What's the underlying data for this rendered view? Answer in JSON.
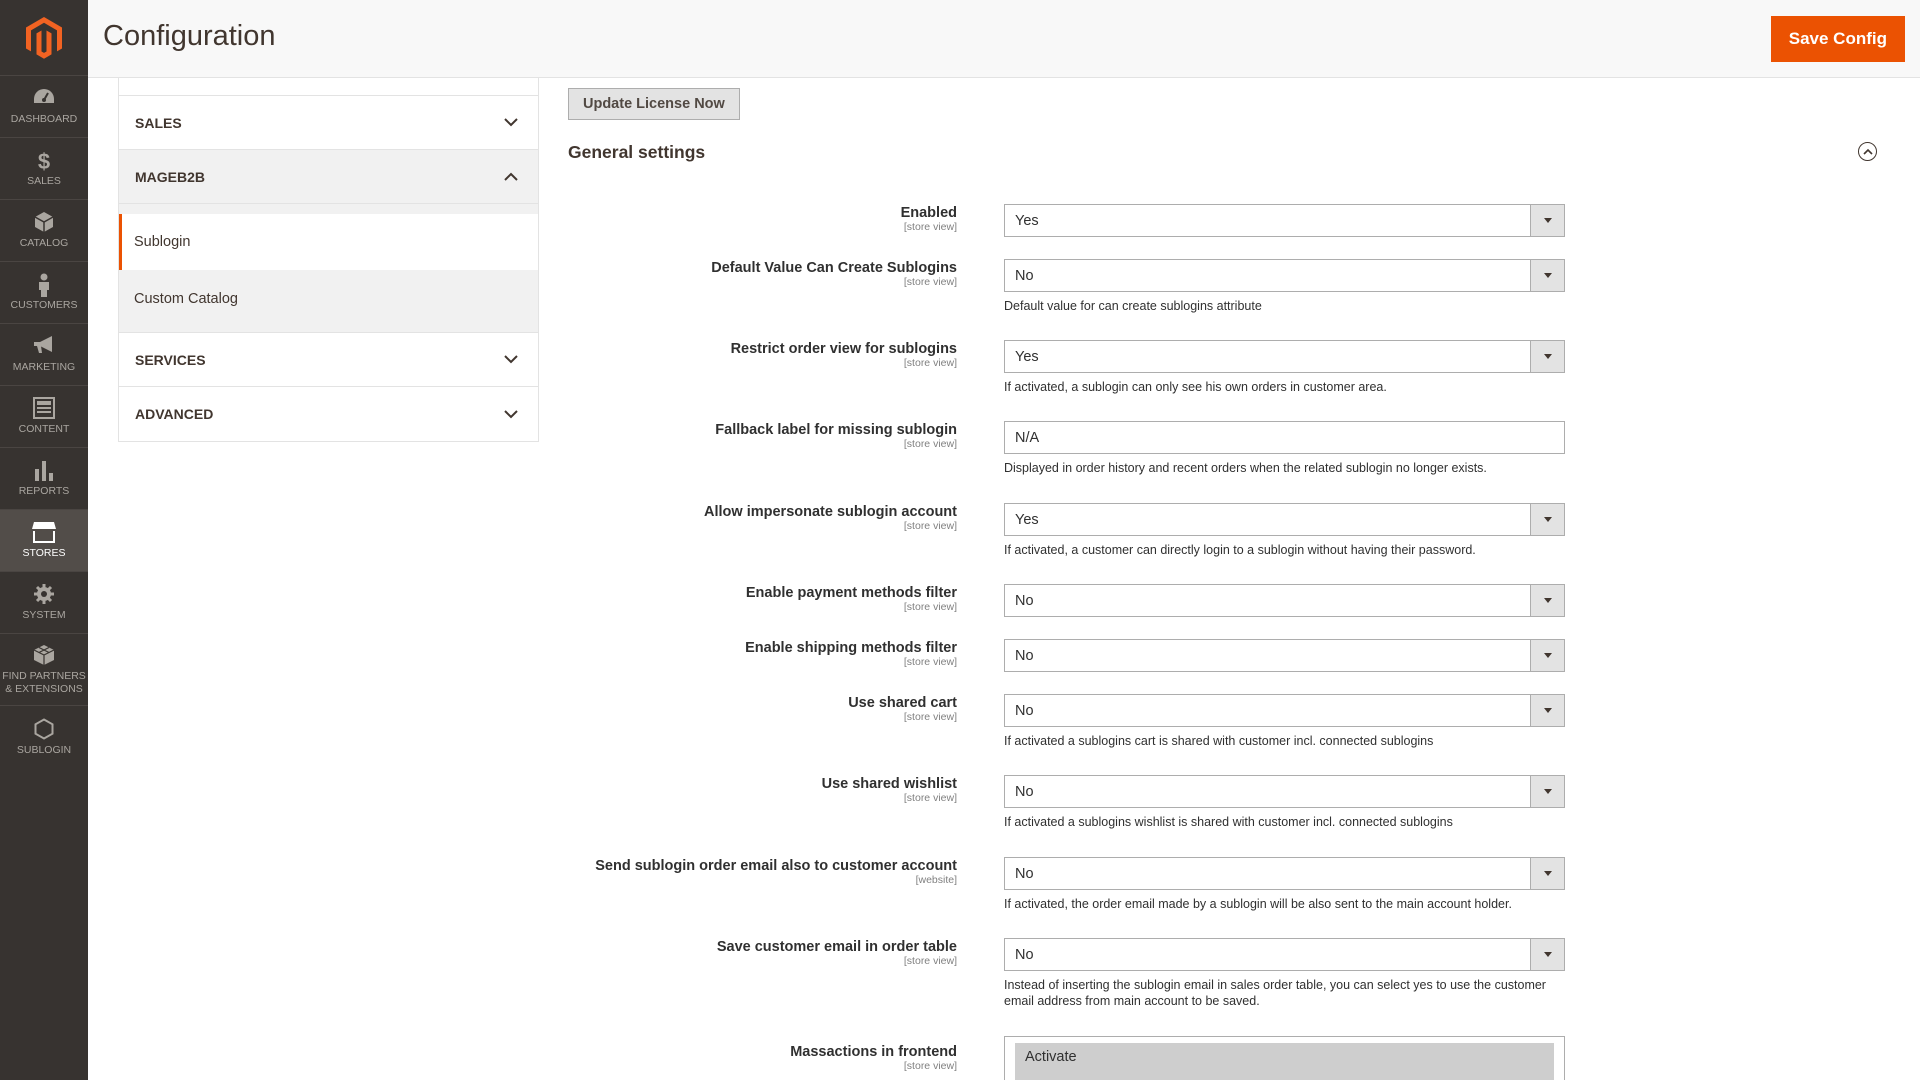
{
  "nav": {
    "items": [
      {
        "label": "DASHBOARD",
        "icon": "dashboard-icon"
      },
      {
        "label": "SALES",
        "icon": "dollar-icon"
      },
      {
        "label": "CATALOG",
        "icon": "box-icon"
      },
      {
        "label": "CUSTOMERS",
        "icon": "person-icon"
      },
      {
        "label": "MARKETING",
        "icon": "megaphone-icon"
      },
      {
        "label": "CONTENT",
        "icon": "layout-icon"
      },
      {
        "label": "REPORTS",
        "icon": "bar-chart-icon"
      },
      {
        "label": "STORES",
        "icon": "store-icon"
      },
      {
        "label": "SYSTEM",
        "icon": "gear-icon"
      },
      {
        "label": "FIND PARTNERS & EXTENSIONS",
        "icon": "cubes-icon"
      },
      {
        "label": "SUBLOGIN",
        "icon": "hexagon-icon"
      }
    ],
    "active": "STORES"
  },
  "header": {
    "title": "Configuration",
    "save_label": "Save Config"
  },
  "tabs": {
    "groups": [
      {
        "label": "SALES"
      },
      {
        "label": "MAGEB2B",
        "items": [
          "Sublogin",
          "Custom Catalog"
        ]
      },
      {
        "label": "SERVICES"
      },
      {
        "label": "ADVANCED"
      }
    ]
  },
  "main": {
    "license_button": "Update License Now",
    "section_title": "General settings",
    "fields": [
      {
        "label": "Enabled",
        "scope": "[store view]",
        "value": "Yes",
        "note": ""
      },
      {
        "label": "Default Value Can Create Sublogins",
        "scope": "[store view]",
        "value": "No",
        "note": "Default value for can create sublogins attribute"
      },
      {
        "label": "Restrict order view for sublogins",
        "scope": "[store view]",
        "value": "Yes",
        "note": "If activated, a sublogin can only see his own orders in customer area."
      },
      {
        "label": "Fallback label for missing sublogin",
        "scope": "[store view]",
        "value": "N/A",
        "note": "Displayed in order history and recent orders when the related sublogin no longer exists."
      },
      {
        "label": "Allow impersonate sublogin account",
        "scope": "[store view]",
        "value": "Yes",
        "note": "If activated, a customer can directly login to a sublogin without having their password."
      },
      {
        "label": "Enable payment methods filter",
        "scope": "[store view]",
        "value": "No",
        "note": ""
      },
      {
        "label": "Enable shipping methods filter",
        "scope": "[store view]",
        "value": "No",
        "note": ""
      },
      {
        "label": "Use shared cart",
        "scope": "[store view]",
        "value": "No",
        "note": "If activated a sublogins cart is shared with customer incl. connected sublogins"
      },
      {
        "label": "Use shared wishlist",
        "scope": "[store view]",
        "value": "No",
        "note": "If activated a sublogins wishlist is shared with customer incl. connected sublogins"
      },
      {
        "label": "Send sublogin order email also to customer account",
        "scope": "[website]",
        "value": "No",
        "note": "If activated, the order email made by a sublogin will be also sent to the main account holder."
      },
      {
        "label": "Save customer email in order table",
        "scope": "[store view]",
        "value": "No",
        "note": "Instead of inserting the sublogin email in sales order table, you can select yes to use the customer email address from main account to be saved."
      },
      {
        "label": "Massactions in frontend",
        "scope": "[store view]",
        "value": "Activate",
        "note": ""
      }
    ]
  },
  "colors": {
    "accent": "#eb5202",
    "nav_bg": "#373330"
  }
}
